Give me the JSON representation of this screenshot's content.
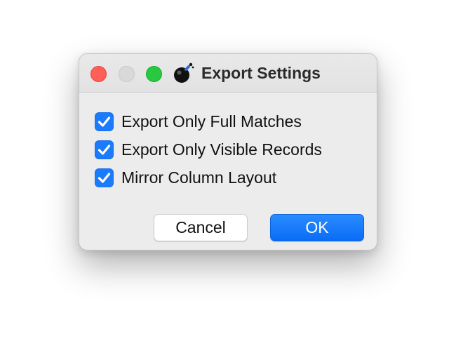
{
  "window": {
    "title": "Export Settings",
    "controls": {
      "close_color": "#fe5f57",
      "minimize_color": "#d9d9d9",
      "zoom_color": "#28c840"
    },
    "icon": "bomb-icon"
  },
  "options": [
    {
      "label": "Export Only Full Matches",
      "checked": true
    },
    {
      "label": "Export Only Visible Records",
      "checked": true
    },
    {
      "label": "Mirror Column Layout",
      "checked": true
    }
  ],
  "buttons": {
    "cancel_label": "Cancel",
    "ok_label": "OK"
  },
  "colors": {
    "accent": "#1a7bfd",
    "window_bg": "#ececec"
  }
}
